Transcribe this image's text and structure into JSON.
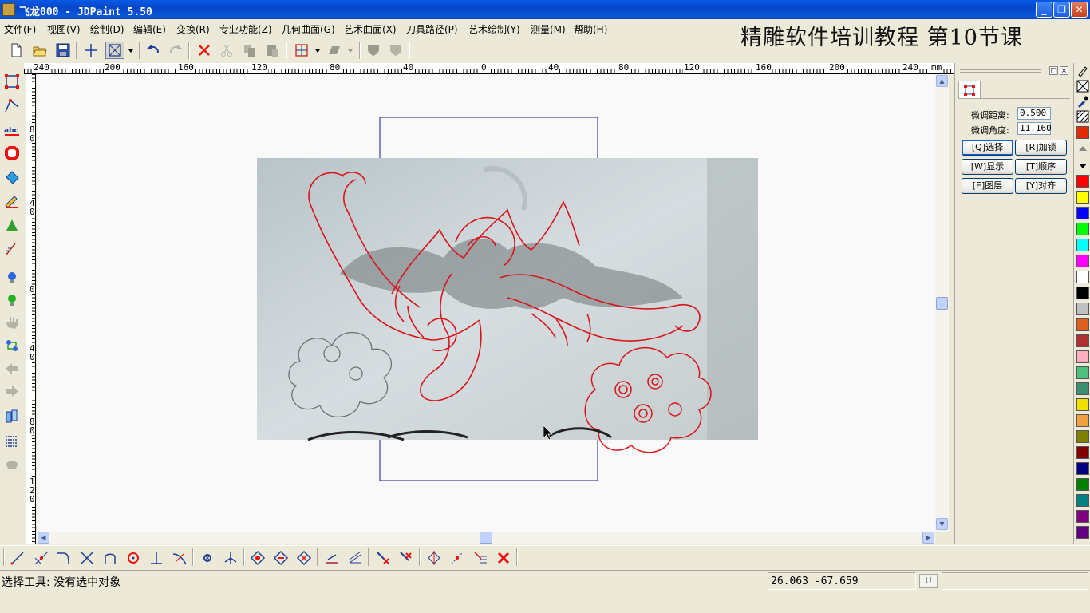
{
  "window": {
    "title": "飞龙000 - JDPaint 5.50",
    "buttons": {
      "minimize": "_",
      "maximize": "❐",
      "close": "✕"
    }
  },
  "menu": [
    "文件(F)",
    "视图(V)",
    "绘制(D)",
    "编辑(E)",
    "变换(R)",
    "专业功能(Z)",
    "几何曲面(G)",
    "艺术曲面(X)",
    "刀具路径(P)",
    "艺术绘制(Y)",
    "测量(M)",
    "帮助(H)"
  ],
  "overlay_caption": "精雕软件培训教程  第10节课",
  "ruler": {
    "unit": "mm",
    "h_labels": [
      "240",
      "200",
      "160",
      "120",
      "80",
      "40",
      "0",
      "40",
      "80",
      "120",
      "160",
      "200",
      "240"
    ],
    "v_labels": [
      "8\n0",
      "4\n0",
      "0",
      "4\n0",
      "8\n0",
      "1\n2\n0"
    ]
  },
  "panel": {
    "fine_distance_label": "微调距离:",
    "fine_distance_value": "0.500",
    "fine_angle_label": "微调角度:",
    "fine_angle_value": "11.160",
    "buttons": {
      "select": "[Q]选择",
      "lock": "[R]加锁",
      "show": "[W]显示",
      "order": "[T]顺序",
      "layer": "[E]图层",
      "align": "[Y]对齐"
    },
    "mini_buttons": {
      "restore": "□",
      "close": "×"
    }
  },
  "palette": {
    "colors": [
      "#e42a00",
      "#ff0000",
      "#ffff00",
      "#0000ff",
      "#00ff00",
      "#00ffff",
      "#ff00ff",
      "#ffffff",
      "#000000",
      "#c0c0c0",
      "#e06020",
      "#b03030",
      "#ffb0c0",
      "#50c080",
      "#3a9070",
      "#f0e000",
      "#f0a040",
      "#808000",
      "#800000",
      "#000080",
      "#008000",
      "#008080",
      "#800080",
      "#600080"
    ]
  },
  "status": {
    "message": "选择工具: 没有选中对象",
    "coordinates": "26.063 -67.659",
    "unit_indicator": "U"
  }
}
